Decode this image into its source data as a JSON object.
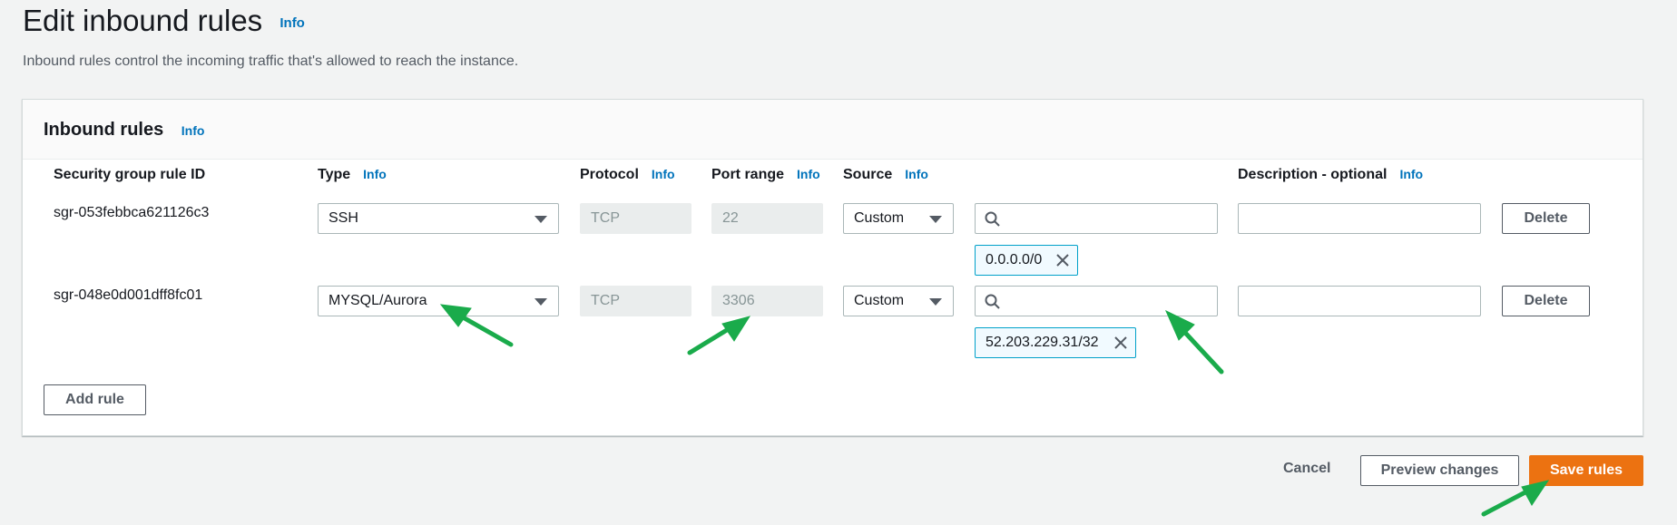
{
  "header": {
    "title": "Edit inbound rules",
    "info": "Info",
    "description": "Inbound rules control the incoming traffic that's allowed to reach the instance."
  },
  "panel": {
    "title": "Inbound rules",
    "info": "Info"
  },
  "columns": {
    "rule_id": "Security group rule ID",
    "type": "Type",
    "type_info": "Info",
    "protocol": "Protocol",
    "protocol_info": "Info",
    "port_range": "Port range",
    "port_range_info": "Info",
    "source": "Source",
    "source_info": "Info",
    "description": "Description - optional",
    "description_info": "Info"
  },
  "rules": [
    {
      "id": "sgr-053febbca621126c3",
      "type": "SSH",
      "protocol": "TCP",
      "port_range": "22",
      "source_type": "Custom",
      "source_search": "",
      "source_token": "0.0.0.0/0",
      "description": "",
      "delete_label": "Delete"
    },
    {
      "id": "sgr-048e0d001dff8fc01",
      "type": "MYSQL/Aurora",
      "protocol": "TCP",
      "port_range": "3306",
      "source_type": "Custom",
      "source_search": "",
      "source_token": "52.203.229.31/32",
      "description": "",
      "delete_label": "Delete"
    }
  ],
  "add_rule_label": "Add rule",
  "footer": {
    "cancel": "Cancel",
    "preview": "Preview changes",
    "save": "Save rules"
  },
  "colors": {
    "accent": "#0073bb",
    "primary_button": "#ec7211",
    "annotation_arrow": "#1aab4b"
  },
  "icons": {
    "search": "search-icon",
    "remove_token": "close-icon",
    "dropdown": "caret-down-icon",
    "annotation": "arrow-annotation"
  }
}
